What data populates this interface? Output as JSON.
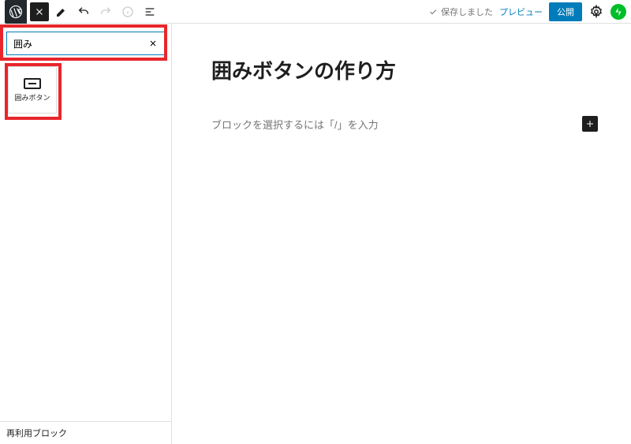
{
  "topbar": {
    "status": "保存しました",
    "preview": "プレビュー",
    "publish": "公開"
  },
  "sidebar": {
    "search_value": "囲み",
    "block": {
      "label": "囲みボタン"
    },
    "reusable": "再利用ブロック"
  },
  "editor": {
    "title": "囲みボタンの作り方",
    "placeholder": "ブロックを選択するには「/」を入力"
  }
}
